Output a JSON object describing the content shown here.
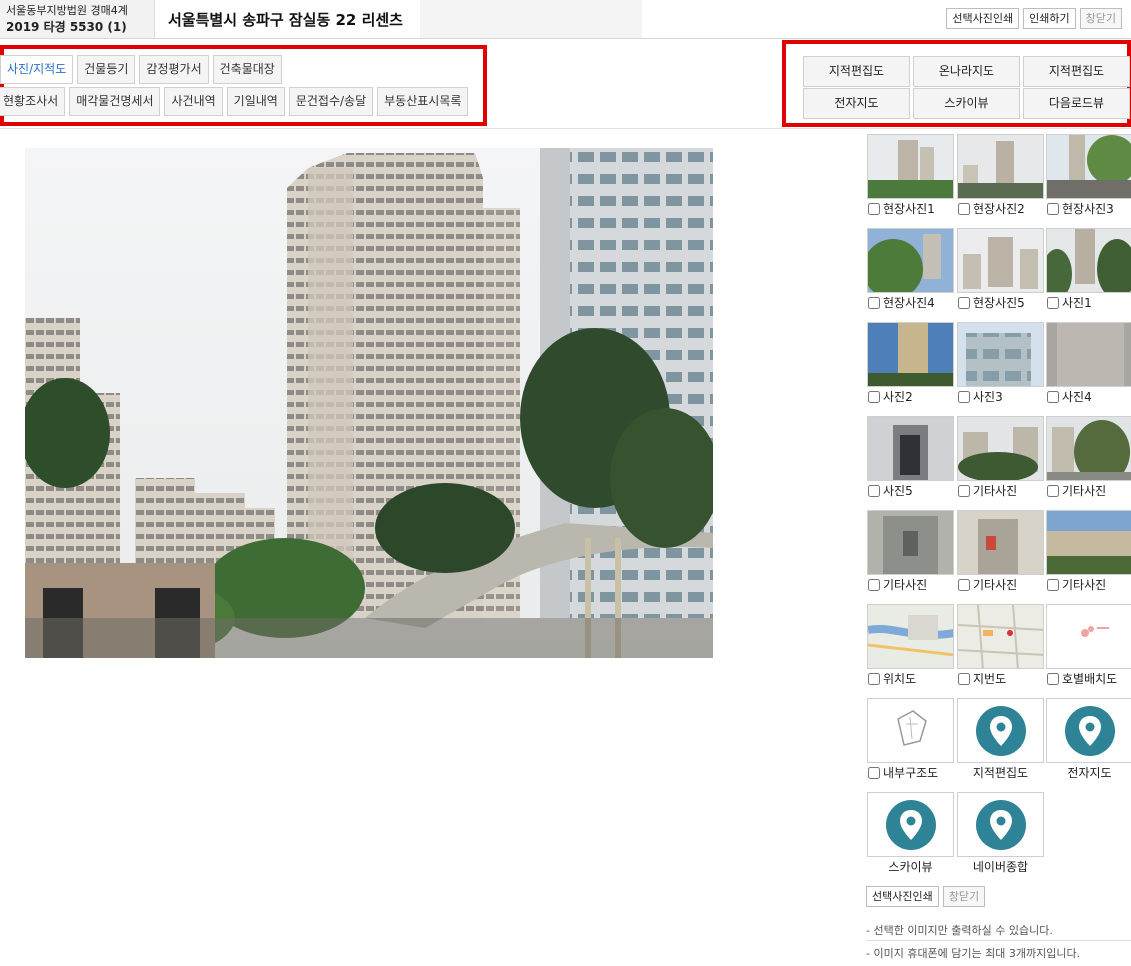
{
  "header": {
    "court": "서울동부지방법원 경매4계",
    "case_number": "2019 타경 5530 (1)",
    "address": "서울특별시 송파구 잠실동 22 리센츠",
    "buttons": [
      "선택사진인쇄",
      "인쇄하기",
      "창닫기"
    ]
  },
  "tabs": {
    "row1": [
      "사진/지적도",
      "건물등기",
      "감정평가서",
      "건축물대장"
    ],
    "row2": [
      "현황조사서",
      "매각물건명세서",
      "사건내역",
      "기일내역",
      "문건접수/송달",
      "부동산표시목록"
    ],
    "active": "사진/지적도"
  },
  "map_buttons": {
    "row1": [
      "지적편집도",
      "온나라지도",
      "지적편집도"
    ],
    "row2": [
      "전자지도",
      "스카이뷰",
      "다음로드뷰"
    ]
  },
  "thumbnails": [
    {
      "label": "현장사진1",
      "checkbox": true
    },
    {
      "label": "현장사진2",
      "checkbox": true
    },
    {
      "label": "현장사진3",
      "checkbox": true
    },
    {
      "label": "현장사진4",
      "checkbox": true
    },
    {
      "label": "현장사진5",
      "checkbox": true
    },
    {
      "label": "사진1",
      "checkbox": true
    },
    {
      "label": "사진2",
      "checkbox": true
    },
    {
      "label": "사진3",
      "checkbox": true
    },
    {
      "label": "사진4",
      "checkbox": true
    },
    {
      "label": "사진5",
      "checkbox": true
    },
    {
      "label": "기타사진",
      "checkbox": true
    },
    {
      "label": "기타사진",
      "checkbox": true
    },
    {
      "label": "기타사진",
      "checkbox": true
    },
    {
      "label": "기타사진",
      "checkbox": true
    },
    {
      "label": "기타사진",
      "checkbox": true
    },
    {
      "label": "위치도",
      "checkbox": true
    },
    {
      "label": "지번도",
      "checkbox": true
    },
    {
      "label": "호별배치도",
      "checkbox": true
    },
    {
      "label": "내부구조도",
      "checkbox": true
    },
    {
      "label": "지적편집도",
      "checkbox": false
    },
    {
      "label": "전자지도",
      "checkbox": false
    },
    {
      "label": "스카이뷰",
      "checkbox": false
    },
    {
      "label": "네이버종합",
      "checkbox": false
    }
  ],
  "bottom_buttons": [
    "선택사진인쇄",
    "창닫기"
  ],
  "notes": [
    "- 선택한 이미지만 출력하실 수 있습니다.",
    "- 이미지 휴대폰에 담기는 최대 3개까지입니다."
  ],
  "colors": {
    "highlight": "#e00000",
    "active_tab": "#2a6fc9",
    "pin": "#2e8397"
  }
}
